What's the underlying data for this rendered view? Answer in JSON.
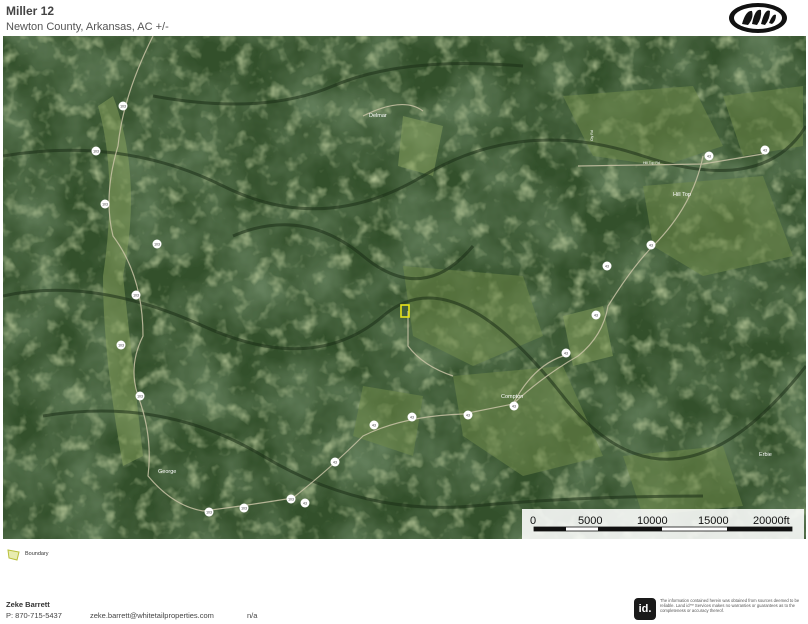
{
  "header": {
    "title": "Miller 12",
    "subtitle": "Newton County, Arkansas,  AC +/-"
  },
  "logo": {
    "icon": "paw-print-icon"
  },
  "map": {
    "place_labels": {
      "delmar": "Delmar",
      "hilltop": "Hill Top",
      "compton": "Compton",
      "george": "George",
      "erbie": "Erbie"
    },
    "road_labels": {
      "cr_top": "Cty Rd",
      "hilltop_rd": "Hill Top Rd"
    },
    "highway_shields": {
      "h103": "103",
      "h43": "43"
    },
    "colors": {
      "forest_dark": "#243b1f",
      "forest": "#33502b",
      "field": "#6f8a4a",
      "boundary": "#e8e41a",
      "shield": "#ffffff"
    }
  },
  "scale": {
    "ticks": [
      "0",
      "5000",
      "10000",
      "15000",
      "20000ft"
    ]
  },
  "legend": {
    "label": "Boundary"
  },
  "agent": {
    "name": "Zeke Barrett",
    "phone": "P: 870-715-5437",
    "email": "zeke.barrett@whitetailproperties.com",
    "extra": "n/a"
  },
  "footer": {
    "id_logo": "id.",
    "disclaimer": "The information contained herein was obtained from sources deemed to be reliable. Land id™ Services makes no warranties or guarantees as to the completeness or accuracy thereof."
  }
}
